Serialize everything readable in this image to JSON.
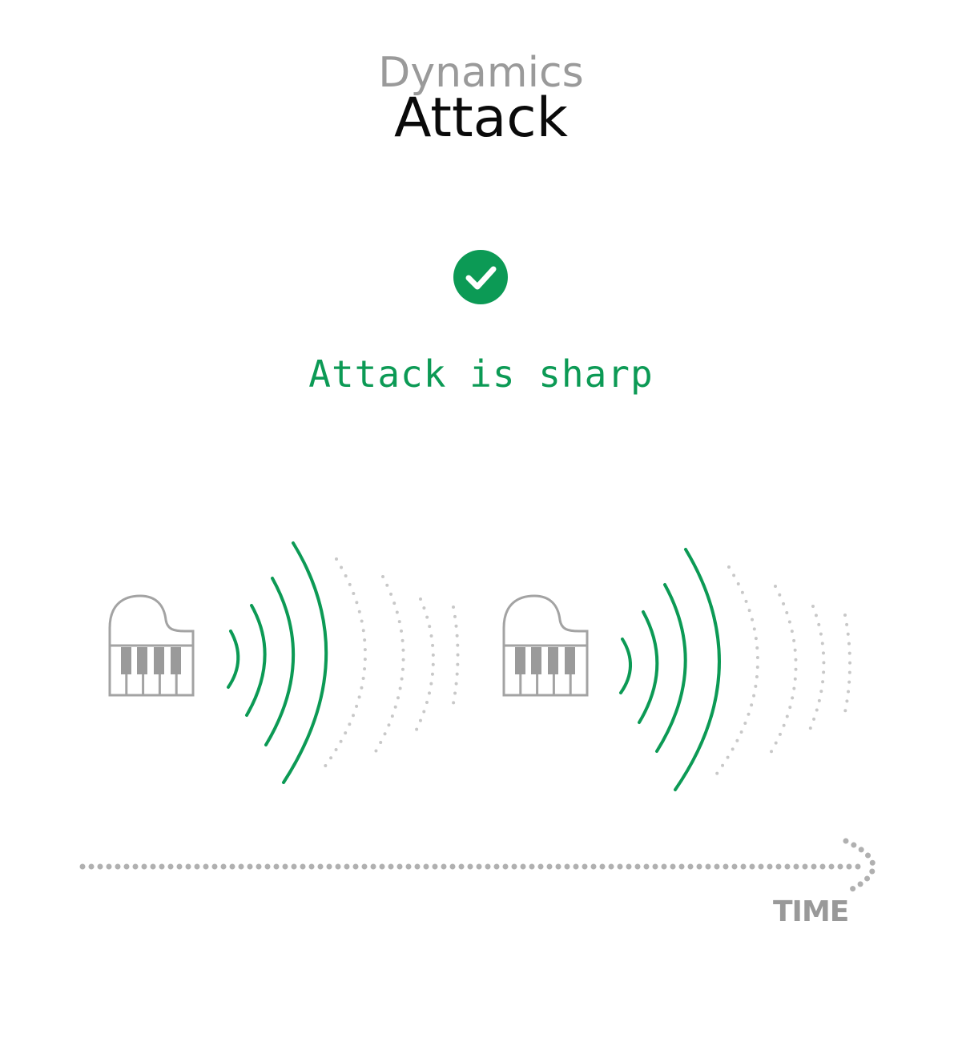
{
  "header": {
    "supertitle": "Dynamics",
    "title": "Attack"
  },
  "status": {
    "icon": "check-circle-icon",
    "text": "Attack is sharp",
    "color": "#0c9a55"
  },
  "instruments": [
    {
      "icon": "grand-piano-icon"
    },
    {
      "icon": "grand-piano-icon"
    }
  ],
  "timeline": {
    "label": "TIME",
    "icon": "arrow-right-icon"
  },
  "colors": {
    "accent": "#0c9a55",
    "muted": "#9a9a9a",
    "wave_faded": "#c8c8c8"
  }
}
